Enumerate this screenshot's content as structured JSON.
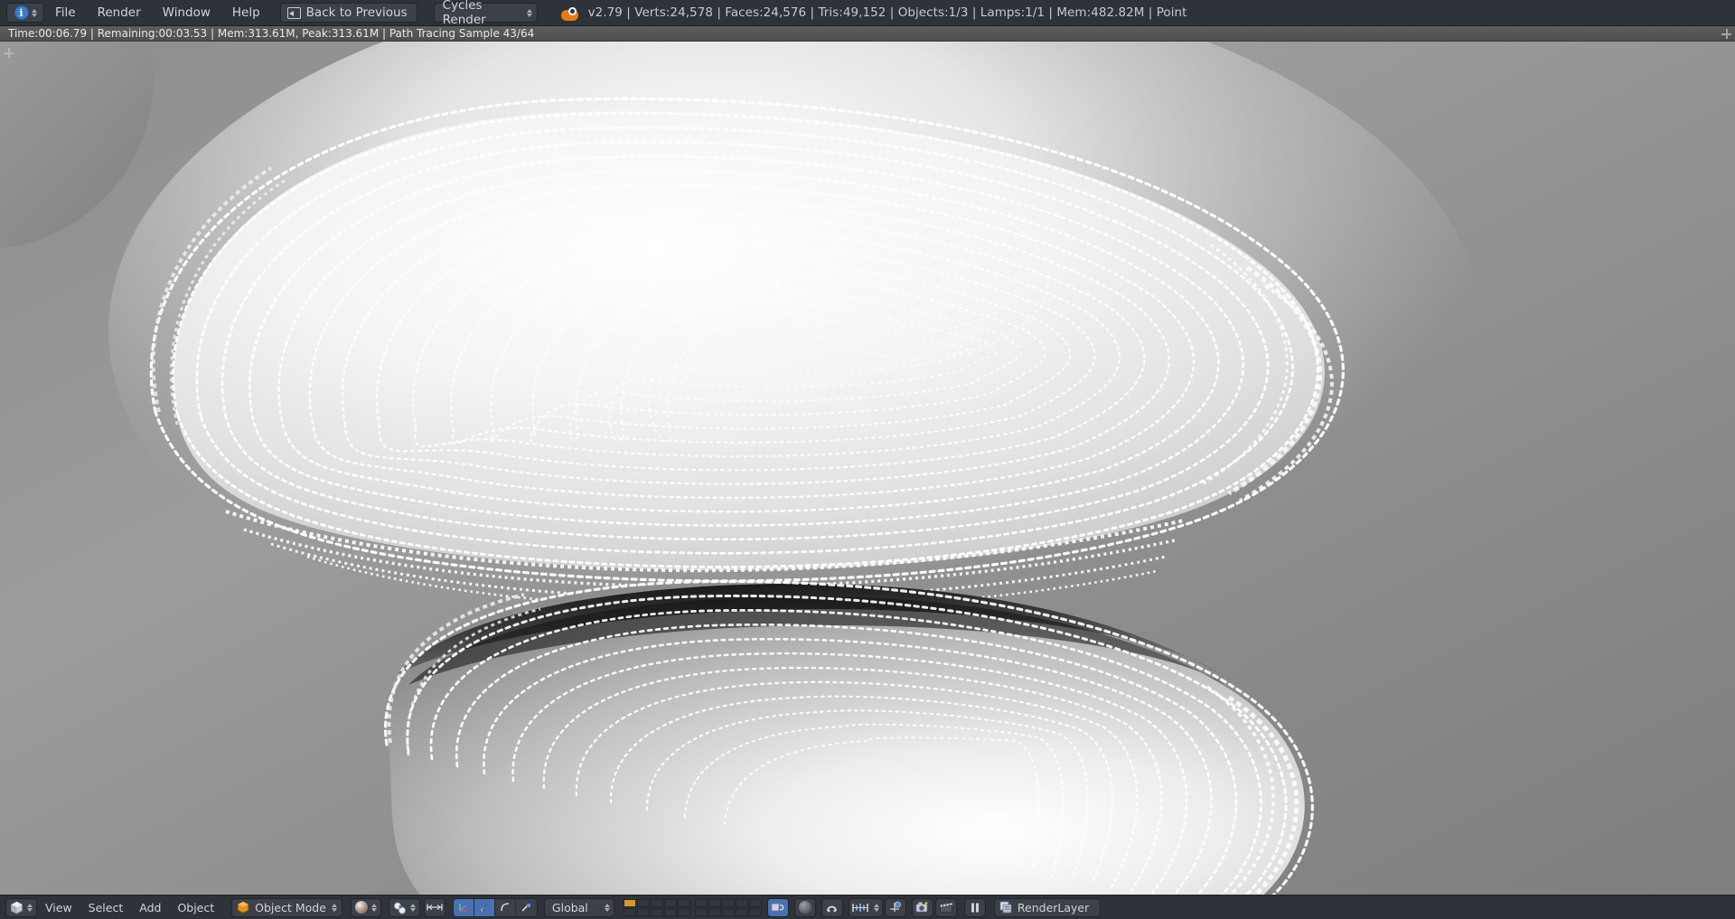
{
  "app": {
    "name": "Blender",
    "version_label": "v2.79"
  },
  "topbar": {
    "editor_type_icon": "info-icon",
    "menus": [
      "File",
      "Render",
      "Window",
      "Help"
    ],
    "back_button": {
      "label": "Back to Previous",
      "icon": "back-arrow-icon"
    },
    "engine_select": {
      "value": "Cycles Render",
      "icon": "chevron-updown-icon"
    },
    "logo_icon": "blender-logo-icon",
    "stats": "v2.79 | Verts:24,578 | Faces:24,576 | Tris:49,152 | Objects:1/3 | Lamps:1/1 | Mem:482.82M | Point",
    "stats_fields": {
      "version": "v2.79",
      "verts": "24,578",
      "faces": "24,576",
      "tris": "49,152",
      "objects": "1/3",
      "lamps": "1/1",
      "mem": "482.82M",
      "active_object": "Point"
    }
  },
  "render_progress": {
    "text": "Time:00:06.79 | Remaining:00:03.53 | Mem:313.61M, Peak:313.61M | Path Tracing Sample 43/64",
    "fields": {
      "time": "00:06.79",
      "remaining": "00:03.53",
      "mem": "313.61M",
      "peak": "313.61M",
      "stage": "Path Tracing Sample",
      "sample_current": 43,
      "sample_total": 64
    },
    "expand_icon": "plus-icon"
  },
  "viewport": {
    "expand_icon": "plus-icon",
    "background": "alpha-checkerboard",
    "description": "Cycles path-traced render of a large torus-like dotted wireframe surface above a second curved body"
  },
  "bottombar": {
    "editor_type_icon": "3d-view-cube-icon",
    "menus": [
      "View",
      "Select",
      "Add",
      "Object"
    ],
    "mode_select": {
      "value": "Object Mode",
      "icon": "object-mode-icon"
    },
    "shading_select": {
      "icon": "material-shading-ball-icon"
    },
    "pivot_select": {
      "icon": "pivot-median-point-icon"
    },
    "proportional_icon": "proportional-edit-icon",
    "manipulator_buttons": [
      {
        "name": "translate-manipulator",
        "active": true
      },
      {
        "name": "rotate-manipulator",
        "active": true
      },
      {
        "name": "scale-manipulator",
        "active": false
      }
    ],
    "transform_orientation": {
      "value": "Global",
      "icon": "chevron-updown-icon"
    },
    "layers": {
      "active_layer_index": 0,
      "rows": 2,
      "cols": 5,
      "blocks": 2
    },
    "lock_camera_icon": "lock-camera-to-view-icon",
    "render_shading_icon": "sphere-icon",
    "snap_magnet_icon": "snap-magnet-icon",
    "snap_target_select": {
      "icon": "snap-increment-icon"
    },
    "snap_element_icon": "snap-element-icon",
    "opengl_render_icon": "opengl-render-image-icon",
    "opengl_render_anim_icon": "opengl-render-animation-clapper-icon",
    "pause_icon": "pause-icon",
    "render_layer": {
      "label": "RenderLayer",
      "icon": "render-layers-icon"
    }
  },
  "colors": {
    "header_bg": "#2e3239",
    "widget_bg": "#3b4049",
    "accent_blue": "#4772b3",
    "accent_orange": "#e87d0d",
    "layer_active": "#d59a2a",
    "text": "#d2d4d8",
    "render_bar_bg": "#565656"
  }
}
